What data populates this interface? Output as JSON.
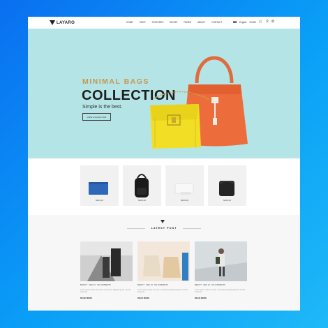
{
  "brand": {
    "name": "LAYARO"
  },
  "nav": {
    "items": [
      "Home",
      "Shop",
      "Features",
      "Blogs",
      "Pages",
      "About",
      "Contact"
    ],
    "language": "English",
    "currency": "$ USD"
  },
  "hero": {
    "subtitle": "MINIMAL BAGS",
    "title": "COLLECTION",
    "tagline": "Simple is the best.",
    "button": "View Collection",
    "colors": {
      "background": "#b5e4e6",
      "accent": "#c6974d"
    }
  },
  "products": [
    {
      "price": "$120.00",
      "name": "Comet Bag Template",
      "desc": "Nam tortor ligula, dignissim ultrices"
    },
    {
      "price": "$180.00",
      "name": "Blackpack Light Edition",
      "desc": "Nam tortor ligula, dignissim ultrices"
    },
    {
      "price": "$150.00",
      "name": "Light Bag Template",
      "desc": "Nam tortor ligula, dignissim ultrices"
    },
    {
      "price": "$120.00",
      "name": "Wallet Bag Template",
      "desc": "Nam tortor ligula, dignissim ultrices"
    }
  ],
  "blog": {
    "heading": "Latest Post",
    "posts": [
      {
        "meta": "Beauty · Dec 24 · No Comments",
        "text": "Lorem ipsum dolor sit amet, consectetur adipisicing elit, sed do eiusmod",
        "more": "Read More"
      },
      {
        "meta": "Beauty · Dec 24 · No Comments",
        "text": "Lorem ipsum dolor sit amet, consectetur adipisicing elit, sed do eiusmod",
        "more": "Read More"
      },
      {
        "meta": "Beauty · Dec 24 · No Comments",
        "text": "Lorem ipsum dolor sit amet, consectetur adipisicing elit, sed do eiusmod",
        "more": "Read More"
      }
    ]
  }
}
